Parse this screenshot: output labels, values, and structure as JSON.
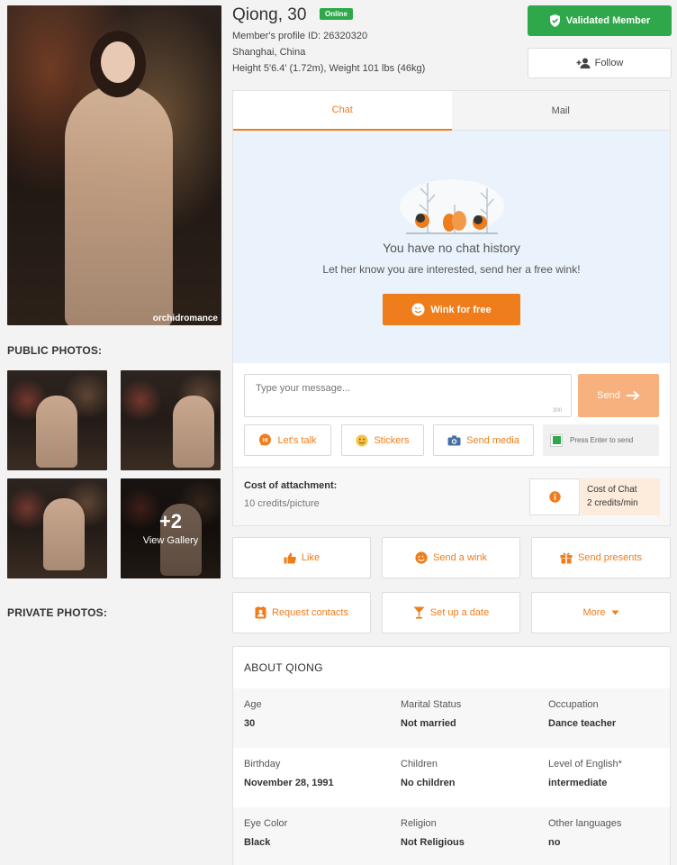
{
  "profile": {
    "name": "Qiong, 30",
    "status": "Online",
    "profile_id": "Member's profile ID: 26320320",
    "location": "Shanghai, China",
    "measurements": "Height 5'6.4' (1.72m), Weight 101 lbs (46kg)",
    "photo_watermark": "orchidromance"
  },
  "header_actions": {
    "validated": "Validated Member",
    "follow": "Follow"
  },
  "photos": {
    "public_label": "PUBLIC PHOTOS:",
    "private_label": "PRIVATE PHOTOS:",
    "more_count": "+2",
    "view_gallery": "View Gallery"
  },
  "chat": {
    "tabs": [
      "Chat",
      "Mail"
    ],
    "empty_title": "You have no chat history",
    "empty_sub": "Let her know you are interested, send her a free wink!",
    "wink_button": "Wink for free",
    "input_placeholder": "Type your message...",
    "counter": "300",
    "send": "Send",
    "tools": [
      "Let's talk",
      "Stickers",
      "Send media"
    ],
    "enter_to_send": "Press Enter to send",
    "cost_attachment_label": "Cost of attachment:",
    "cost_attachment_value": "10 credits/picture",
    "cost_chat_label": "Cost of Chat",
    "cost_chat_value": "2 credits/min"
  },
  "actions": [
    "Like",
    "Send a wink",
    "Send presents",
    "Request contacts",
    "Set up a date",
    "More"
  ],
  "about": {
    "title": "ABOUT QIONG",
    "rows": [
      [
        {
          "k": "Age",
          "v": "30"
        },
        {
          "k": "Marital Status",
          "v": "Not married"
        },
        {
          "k": "Occupation",
          "v": "Dance teacher"
        }
      ],
      [
        {
          "k": "Birthday",
          "v": "November 28, 1991"
        },
        {
          "k": "Children",
          "v": "No children"
        },
        {
          "k": "Level of English*",
          "v": "intermediate"
        }
      ],
      [
        {
          "k": "Eye Color",
          "v": "Black"
        },
        {
          "k": "Religion",
          "v": "Not Religious"
        },
        {
          "k": "Other languages",
          "v": "no"
        }
      ]
    ]
  },
  "colors": {
    "accent": "#ef7d1b",
    "success": "#2ea84a",
    "panel_bg": "#eaf3fb"
  },
  "icons": [
    "shield-check-icon",
    "follow-user-icon",
    "send-arrow-icon",
    "hi-bubble-icon",
    "sticker-icon",
    "camera-icon",
    "checkbox-icon",
    "info-icon",
    "thumb-up-icon",
    "wink-face-icon",
    "gift-icon",
    "contacts-icon",
    "cocktail-icon",
    "caret-down-icon"
  ]
}
